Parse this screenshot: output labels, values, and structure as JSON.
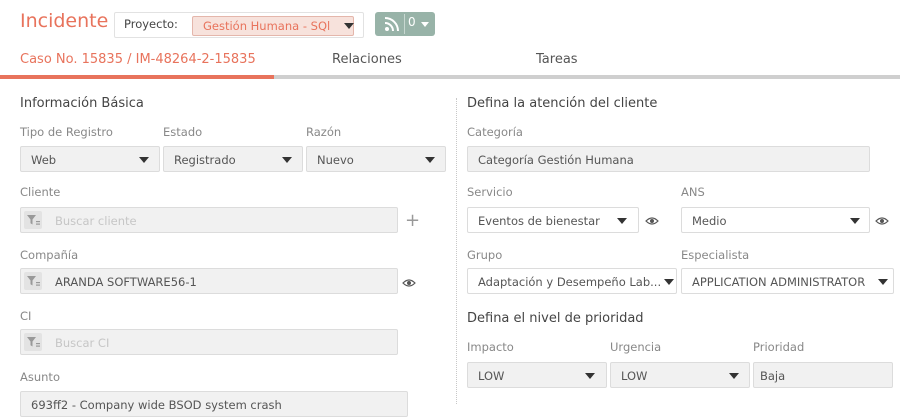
{
  "header": {
    "title": "Incidente",
    "project_label": "Proyecto:",
    "project_value": "Gestión Humana - SQl",
    "rss_count": "0"
  },
  "tabs": [
    {
      "label": "Caso No. 15835 / IM-48264-2-15835"
    },
    {
      "label": "Relaciones"
    },
    {
      "label": "Tareas"
    }
  ],
  "basic_info": {
    "heading": "Información Básica",
    "tipo_registro": {
      "label": "Tipo de Registro",
      "value": "Web"
    },
    "estado": {
      "label": "Estado",
      "value": "Registrado"
    },
    "razon": {
      "label": "Razón",
      "value": "Nuevo"
    },
    "cliente": {
      "label": "Cliente",
      "placeholder": "Buscar cliente"
    },
    "compania": {
      "label": "Compañía",
      "value": "ARANDA SOFTWARE56-1"
    },
    "ci": {
      "label": "CI",
      "placeholder": "Buscar CI"
    },
    "asunto": {
      "label": "Asunto",
      "value": "693ff2 - Company wide BSOD system crash"
    }
  },
  "attention": {
    "heading": "Defina la atención del cliente",
    "categoria": {
      "label": "Categoría",
      "value": "Categoría Gestión Humana"
    },
    "servicio": {
      "label": "Servicio",
      "value": "Eventos de bienestar"
    },
    "ans": {
      "label": "ANS",
      "value": "Medio"
    },
    "grupo": {
      "label": "Grupo",
      "value": "Adaptación y Desempeño Lab..."
    },
    "especialista": {
      "label": "Especialista",
      "value": "APPLICATION ADMINISTRATOR"
    }
  },
  "priority": {
    "heading": "Defina el nivel de prioridad",
    "impacto": {
      "label": "Impacto",
      "value": "LOW"
    },
    "urgencia": {
      "label": "Urgencia",
      "value": "LOW"
    },
    "prioridad": {
      "label": "Prioridad",
      "value": "Baja"
    }
  },
  "colors": {
    "accent": "#e8735c",
    "rss_button": "#98b3a8"
  }
}
